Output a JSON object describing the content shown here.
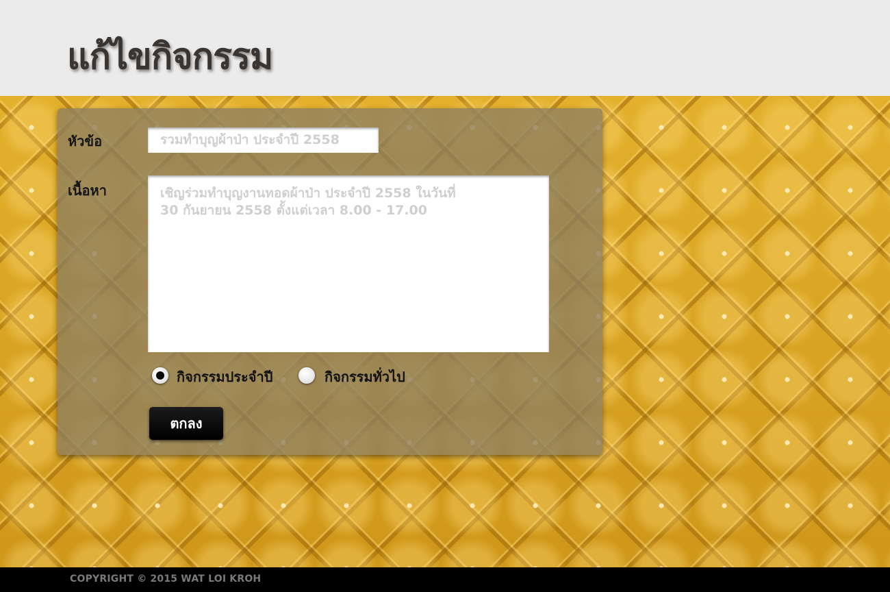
{
  "header": {
    "title": "แก้ไขกิจกรรม"
  },
  "form": {
    "topic_label": "หัวข้อ",
    "topic_value": "รวมทำบุญผ้าป่า ประจำปี 2558",
    "content_label": "เนื้อหา",
    "content_value": "เชิญร่วมทำบุญงานทอดผ้าป่า ประจำปี 2558 ในวันที่\n30 กันยายน 2558 ตั้งแต่เวลา 8.00 - 17.00",
    "activity_type": {
      "options": [
        "กิจกรรมประจำปี",
        "กิจกรรมทั่วไป"
      ],
      "selected": "กิจกรรมประจำปี"
    },
    "submit_label": "ตกลง"
  },
  "footer": {
    "copyright": "COPYRIGHT © 2015 WAT LOI KROH"
  },
  "colors": {
    "header_bg": "#ebebeb",
    "background_gold": "#d9a21e",
    "panel": "#8c7d5f",
    "button": "#000000",
    "footer_bg": "#000000"
  }
}
